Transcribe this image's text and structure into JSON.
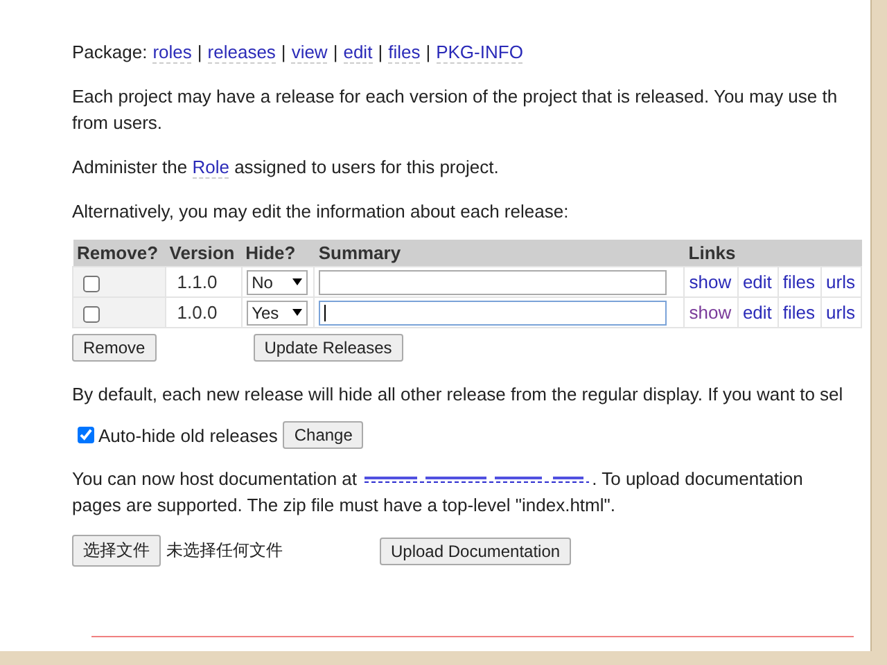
{
  "package_nav": {
    "label": "Package:",
    "separator": "|",
    "links": [
      "roles",
      "releases",
      "view",
      "edit",
      "files",
      "PKG-INFO"
    ]
  },
  "intro": "Each project may have a release for each version of the project that is released. You may use th\nfrom users.",
  "role_note": {
    "before": "Administer the ",
    "link": "Role",
    "after": " assigned to users for this project."
  },
  "edit_note": "Alternatively, you may edit the information about each release:",
  "table": {
    "columns": [
      "Remove?",
      "Version",
      "Hide?",
      "Summary",
      "Links"
    ],
    "rows": [
      {
        "checked": false,
        "version": "1.1.0",
        "hide": "No",
        "summary": "",
        "focused": false,
        "links": [
          {
            "label": "show",
            "visited": false
          },
          {
            "label": "edit",
            "visited": false
          },
          {
            "label": "files",
            "visited": false
          },
          {
            "label": "urls",
            "visited": false
          }
        ]
      },
      {
        "checked": false,
        "version": "1.0.0",
        "hide": "Yes",
        "summary": "",
        "focused": true,
        "links": [
          {
            "label": "show",
            "visited": true
          },
          {
            "label": "edit",
            "visited": false
          },
          {
            "label": "files",
            "visited": false
          },
          {
            "label": "urls",
            "visited": false
          }
        ]
      }
    ]
  },
  "table_buttons": [
    "Remove",
    "Update Releases"
  ],
  "default_note": "By default, each new release will hide all other release from the regular display. If you want to sel",
  "autohide": {
    "label": "Auto-hide old releases",
    "checked": true,
    "button": "Change"
  },
  "docs_note": {
    "before": "You can now host documentation at ",
    "after": ". To upload documentation\npages are supported. The zip file must have a top-level \"index.html\"."
  },
  "upload": {
    "choose_button": "选择文件",
    "file_status": "未选择任何文件",
    "upload_button": "Upload Documentation"
  }
}
